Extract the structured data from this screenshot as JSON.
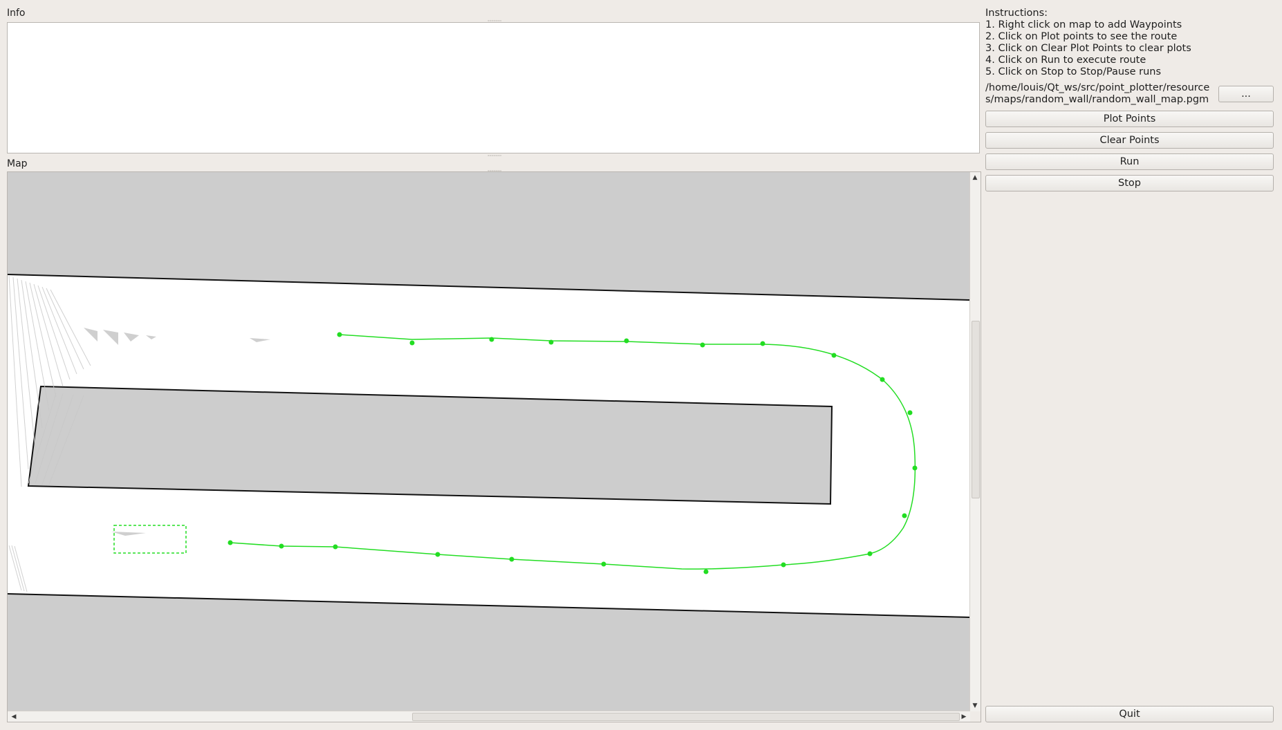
{
  "info": {
    "label": "Info",
    "text": ""
  },
  "map": {
    "label": "Map",
    "file": "random_wall_map.pgm"
  },
  "instructions": {
    "title": "Instructions:",
    "steps": [
      "1. Right click on map to add Waypoints",
      "2. Click on Plot points to see the route",
      "3. Click on Clear Plot Points to clear plots",
      "4. Click on Run to execute route",
      "5. Click on Stop to Stop/Pause runs"
    ]
  },
  "file_path": "/home/louis/Qt_ws/src/point_plotter/resources/maps/random_wall/random_wall_map.pgm",
  "buttons": {
    "browse": "...",
    "plot": "Plot Points",
    "clear": "Clear Points",
    "run": "Run",
    "stop": "Stop",
    "quit": "Quit"
  },
  "colors": {
    "route": "#22dd22",
    "unknown": "#cdcdcd",
    "free": "#ffffff",
    "wall": "#111111"
  }
}
